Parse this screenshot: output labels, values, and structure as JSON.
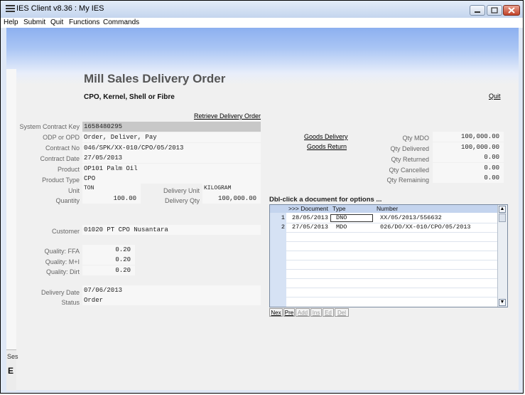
{
  "window": {
    "title": "IES Client v8.36 : My IES"
  },
  "menu": [
    "Help",
    "Submit",
    "Quit",
    "Functions",
    "Commands"
  ],
  "header": {
    "title": "Mill Sales Delivery Order",
    "subtitle": "CPO, Kernel, Shell or Fibre",
    "quit": "Quit",
    "retrieve": "Retrieve Delivery Order"
  },
  "fields": {
    "system_contract_key": {
      "label": "System Contract Key",
      "value": "1658480295"
    },
    "odp_opd": {
      "label": "ODP or OPD",
      "value": "Order, Deliver, Pay"
    },
    "contract_no": {
      "label": "Contract No",
      "value": "046/SPK/XX-010/CPO/05/2013"
    },
    "contract_date": {
      "label": "Contract Date",
      "value": "27/05/2013"
    },
    "product": {
      "label": "Product",
      "value": "OP101 Palm Oil"
    },
    "product_type": {
      "label": "Product Type",
      "value": "CPO"
    },
    "unit": {
      "label": "Unit",
      "value": "TON"
    },
    "quantity": {
      "label": "Quantity",
      "value": "100.00"
    },
    "delivery_unit": {
      "label": "Delivery Unit",
      "value": "KILOGRAM"
    },
    "delivery_qty": {
      "label": "Delivery Qty",
      "value": "100,000.00"
    },
    "customer": {
      "label": "Customer",
      "value": "01020 PT CPO Nusantara"
    },
    "quality_ffa": {
      "label": "Quality: FFA",
      "value": "0.20"
    },
    "quality_mi": {
      "label": "Quality: M+I",
      "value": "0.20"
    },
    "quality_dirt": {
      "label": "Quality: Dirt",
      "value": "0.20"
    },
    "delivery_date": {
      "label": "Delivery Date",
      "value": "07/06/2013"
    },
    "status": {
      "label": "Status",
      "value": "Order"
    }
  },
  "links": {
    "goods_delivery": "Goods Delivery",
    "goods_return": "Goods Return"
  },
  "qty": {
    "mdo": {
      "label": "Qty MDO",
      "value": "100,000.00"
    },
    "delivered": {
      "label": "Qty Delivered",
      "value": "100,000.00"
    },
    "returned": {
      "label": "Qty Returned",
      "value": "0.00"
    },
    "cancelled": {
      "label": "Qty Cancelled",
      "value": "0.00"
    },
    "remaining": {
      "label": "Qty Remaining",
      "value": "0.00"
    }
  },
  "grid": {
    "label": "Dbl-click a document for options ...",
    "headers": [
      ">>> Document",
      "Type",
      "Number"
    ],
    "rows": [
      {
        "n": "1",
        "date": "28/05/2013",
        "type": "DNO",
        "number": "XX/05/2013/556632"
      },
      {
        "n": "2",
        "date": "27/05/2013",
        "type": "MDO",
        "number": "026/DO/XX-010/CPO/05/2013"
      }
    ],
    "buttons": [
      "Nex",
      "Pre",
      "Add",
      "Ins",
      "Ed",
      "Del"
    ]
  },
  "session": {
    "s1": "Ses",
    "s2": "E"
  }
}
